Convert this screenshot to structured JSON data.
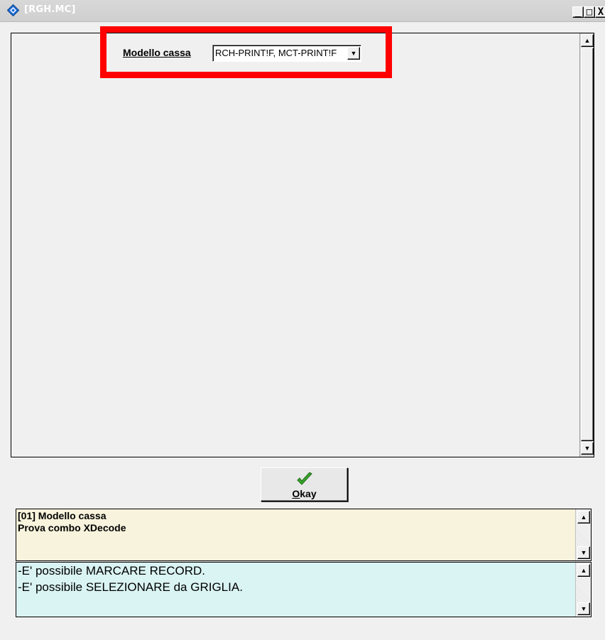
{
  "window": {
    "title": "[RGH.MC]",
    "minimize_glyph": "_",
    "maximize_glyph": "□",
    "close_glyph": "X"
  },
  "form": {
    "field_label": "Modello cassa",
    "combo_value": "RCH-PRINT!F, MCT-PRINT!F",
    "combo_arrow": "▼",
    "highlight_color": "#ff0000"
  },
  "scrollbar": {
    "up_arrow": "▲",
    "down_arrow": "▼"
  },
  "okay_button": {
    "icon": "checkmark-icon",
    "mnemonic": "O",
    "label_rest": "kay"
  },
  "info_panel": {
    "line1": "[01] Modello cassa",
    "line2": "Prova combo XDecode",
    "background": "#f7f3dc"
  },
  "hint_panel": {
    "line1": "-E' possibile MARCARE RECORD.",
    "line2": "-E' possibile SELEZIONARE da GRIGLIA.",
    "background": "#daf3f3"
  }
}
